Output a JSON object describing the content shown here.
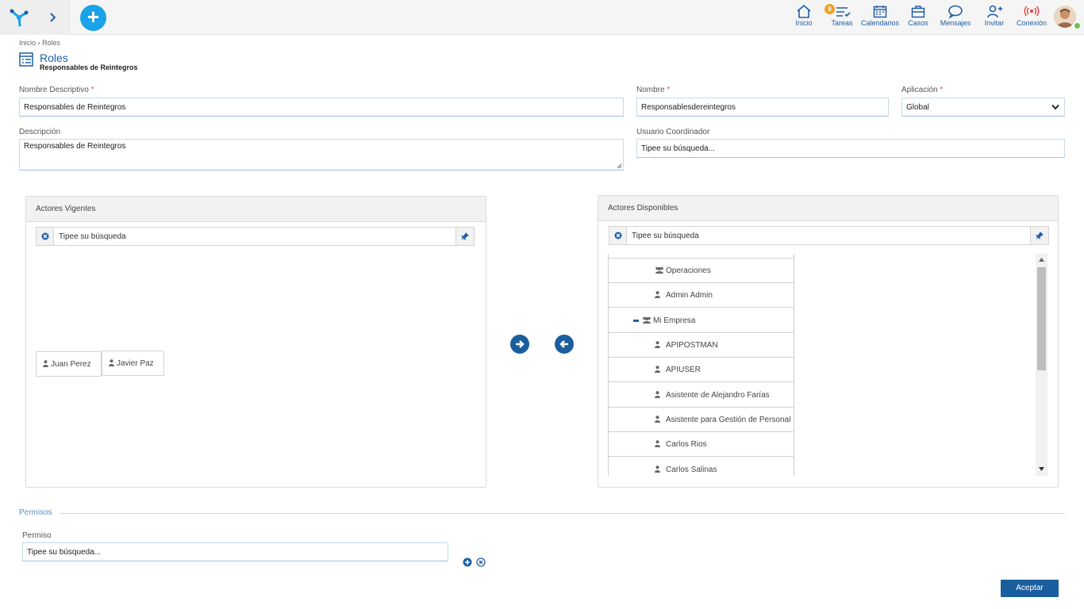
{
  "nav": {
    "items": [
      {
        "label": "Inicio",
        "icon": "home-icon"
      },
      {
        "label": "Tareas",
        "icon": "tasks-icon",
        "badge": "9"
      },
      {
        "label": "Calendarios",
        "icon": "calendar-icon"
      },
      {
        "label": "Casos",
        "icon": "briefcase-icon"
      },
      {
        "label": "Mensajes",
        "icon": "chat-icon"
      },
      {
        "label": "Invitar",
        "icon": "invite-user-icon"
      },
      {
        "label": "Conexión",
        "icon": "signal-icon"
      }
    ],
    "plus": "+"
  },
  "breadcrumb": {
    "home": "Inicio",
    "sep": "›",
    "current": "Roles"
  },
  "page": {
    "title": "Roles",
    "subtitle": "Responsables de Reintegros"
  },
  "form": {
    "nombre_descriptivo_label": "Nombre Descriptivo",
    "nombre_descriptivo_value": "Responsables de Reintegros",
    "nombre_label": "Nombre",
    "nombre_value": "Responsablesdereintegros",
    "aplicacion_label": "Aplicación",
    "aplicacion_value": "Global",
    "descripcion_label": "Descripción",
    "descripcion_value": "Responsables de Reintegros",
    "usuario_label": "Usuario Coordinador",
    "usuario_placeholder": "Tipee su búsqueda..."
  },
  "actores_vigentes": {
    "title": "Actores Vigentes",
    "search_placeholder": "Tipee su búsqueda",
    "chips": [
      "Juan Perez",
      "Javier Paz"
    ]
  },
  "actores_disponibles": {
    "title": "Actores Disponibles",
    "search_placeholder": "Tipee su búsqueda",
    "rows": [
      {
        "label": "Operaciones",
        "type": "group"
      },
      {
        "label": "Admin Admin",
        "type": "user"
      },
      {
        "label": "Mi Empresa",
        "type": "group-collapse"
      },
      {
        "label": "APIPOSTMAN",
        "type": "user"
      },
      {
        "label": "APIUSER",
        "type": "user"
      },
      {
        "label": "Asistente de Alejandro Farías",
        "type": "user"
      },
      {
        "label": "Asistente para Gestión de Personal",
        "type": "user"
      },
      {
        "label": "Carlos Rios",
        "type": "user"
      },
      {
        "label": "Carlos Salinas",
        "type": "user"
      }
    ]
  },
  "permisos": {
    "section_title": "Permisos",
    "permiso_label": "Permiso",
    "permiso_placeholder": "Tipee su búsqueda..."
  },
  "footer": {
    "accept": "Aceptar"
  },
  "colors": {
    "accent": "#1b5e9e",
    "plus": "#1aa3e8",
    "badge": "#f0a020"
  }
}
